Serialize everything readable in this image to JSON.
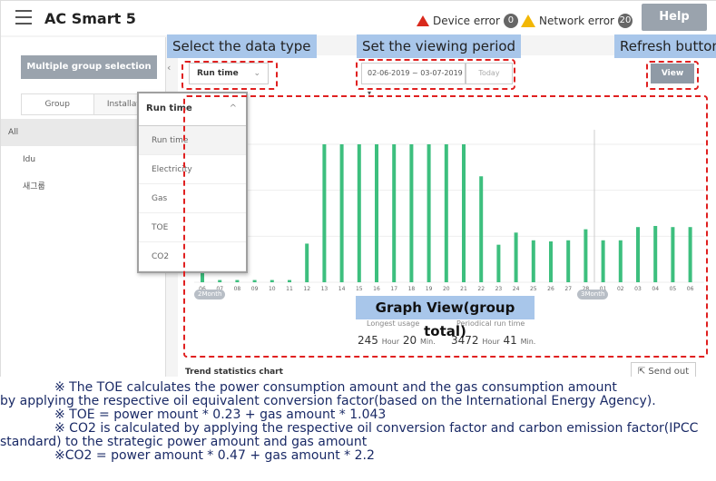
{
  "header": {
    "menu_icon": "hamburger-icon",
    "title": "AC Smart 5",
    "device_error_label": "Device error",
    "device_error_count": "0",
    "network_error_label": "Network error",
    "network_error_count": "20",
    "help_label": "Help",
    "colors": {
      "device_error": "#d9291c",
      "network_error": "#f2b705"
    }
  },
  "sidebar": {
    "multi_group_label": "Multiple group selection",
    "tabs": [
      {
        "label": "Group"
      },
      {
        "label": "Installation"
      }
    ],
    "items": [
      {
        "label": "All"
      },
      {
        "label": "Idu"
      },
      {
        "label": "새그룹"
      }
    ],
    "collapse_icon": "chevron-left-icon"
  },
  "toolbar": {
    "data_type_value": "Run time",
    "period_value": "02-06-2019 ~ 03-07-2019 ▾",
    "today_label": "Today",
    "view_label": "View"
  },
  "data_type_dropdown": {
    "selected": "Run time",
    "options": [
      "Run time",
      "Electricity",
      "Gas",
      "TOE",
      "CO2"
    ]
  },
  "stats": {
    "longest_label": "Longest usage",
    "longest_hours": "245",
    "longest_minutes": "20",
    "periodical_label": "Periodical run time",
    "periodical_hours": "3472",
    "periodical_minutes": "41",
    "hour_unit": "Hour",
    "minute_unit": "Min."
  },
  "trend": {
    "title": "Trend statistics chart",
    "send_out_label": "Send out",
    "send_out_icon": "export-icon"
  },
  "chart_data": {
    "type": "bar",
    "categories": [
      "06",
      "07",
      "08",
      "09",
      "10",
      "11",
      "12",
      "13",
      "14",
      "15",
      "16",
      "17",
      "18",
      "19",
      "20",
      "21",
      "22",
      "23",
      "24",
      "25",
      "26",
      "27",
      "28",
      "01",
      "02",
      "03",
      "04",
      "05",
      "06"
    ],
    "values": [
      1.5,
      0.2,
      0.2,
      0.2,
      0.2,
      0.2,
      3.5,
      12.5,
      12.5,
      12.5,
      12.5,
      12.5,
      12.5,
      12.5,
      12.5,
      12.5,
      9.6,
      3.4,
      4.5,
      3.8,
      3.7,
      3.8,
      4.8,
      3.8,
      3.8,
      5.0,
      5.1,
      5.0,
      5.0
    ],
    "color": "#3dbf7e",
    "month_labels": [
      "2Month",
      "3Month"
    ],
    "grid": true
  },
  "annotations": {
    "data_type": "Select the data type",
    "period": "Set the viewing period",
    "refresh": "Refresh button",
    "graph_view": "Graph View(group total)",
    "highlight_color": "#a8c6ea",
    "dash_color": "#e02020"
  },
  "notes": [
    "※ The TOE calculates the power consumption amount and the gas consumption amount",
    "by applying the respective oil equivalent conversion factor(based on the International Energy Agency).",
    "※ TOE = power mount * 0.23 + gas amount * 1.043",
    "※ CO2 is calculated by applying the respective oil conversion factor and carbon emission factor(IPCC",
    "standard) to the strategic power amount and gas amount",
    "※CO2 = power amount * 0.47 + gas amount * 2.2"
  ]
}
